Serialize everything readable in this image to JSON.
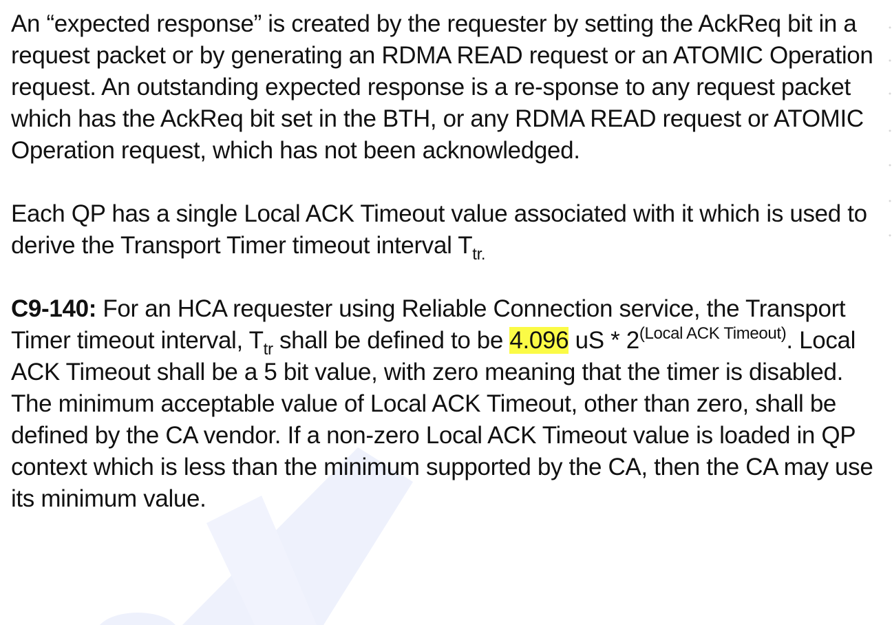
{
  "paragraphs": {
    "p1": "An “expected response” is created by the requester by setting the AckReq bit in a request packet or by generating an RDMA READ request or an ATOMIC Operation request. An outstanding expected response is a re-sponse to any request packet which has the AckReq bit set in the BTH, or any RDMA READ request or ATOMIC Operation request, which has not been acknowledged.",
    "p2_text": "Each QP has a single Local ACK Timeout value associated with it which is used to derive the Transport Timer timeout interval T",
    "p2_sub": "tr.",
    "p3": {
      "id": "C9-140:",
      "text1": " For an HCA requester using Reliable Connection service, the Transport Timer timeout interval, T",
      "sub": "tr",
      "text2": " shall be defined to be ",
      "highlight": "4.096",
      "text3": " uS * 2",
      "sup": "(Local ACK Timeout)",
      "text4": ". Local ACK Timeout shall be a 5 bit value, with zero meaning that the timer is disabled. The minimum acceptable value of Local ACK Timeout, other than zero, shall be defined by the CA vendor. If a non-zero Local ACK Timeout value is loaded in QP context which is less than the minimum supported by the CA, then the CA may use its minimum value."
    }
  },
  "colors": {
    "highlight": "#fbfb46",
    "watermark": "#eef1fc"
  }
}
